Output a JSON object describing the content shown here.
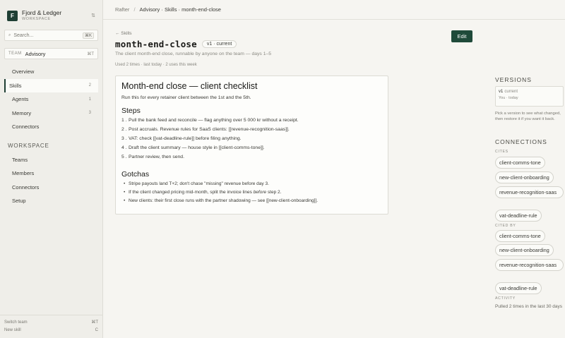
{
  "org": {
    "logo_letter": "F",
    "name": "Fjord & Ledger",
    "subtitle": "WORKSPACE",
    "chevron": "⇅"
  },
  "search": {
    "placeholder": "Search...",
    "shortcut": "⌘K"
  },
  "team": {
    "label": "TEAM",
    "value": "Advisory",
    "shortcut": "⌘T"
  },
  "nav": {
    "items": [
      {
        "label": "Overview",
        "count": ""
      },
      {
        "label": "Skills",
        "count": "2"
      },
      {
        "label": "Agents",
        "count": "1"
      },
      {
        "label": "Memory",
        "count": "3"
      },
      {
        "label": "Connectors",
        "count": ""
      }
    ],
    "workspace_heading": "WORKSPACE",
    "workspace_items": [
      {
        "label": "Teams"
      },
      {
        "label": "Members"
      },
      {
        "label": "Connectors"
      },
      {
        "label": "Setup"
      }
    ]
  },
  "footer": [
    {
      "label": "Switch team",
      "shortcut": "⌘T"
    },
    {
      "label": "New skill",
      "shortcut": "C"
    }
  ],
  "breadcrumb": {
    "root": "Rafter",
    "separator": "/",
    "path": "Advisory · Skills · month-end-close"
  },
  "page": {
    "back_link": "← Skills",
    "title": "month-end-close",
    "version_badge": "v1 · current",
    "subtitle": "The client month-end close, runnable by anyone on the team — days 1–5",
    "meta": "Used 2 times · last today · 2 uses this week",
    "edit_label": "Edit"
  },
  "doc": {
    "h1": "Month-end close — client checklist",
    "intro": "Run this for every retainer client between the 1st and the 5th.",
    "steps_heading": "Steps",
    "steps": [
      {
        "num": "1 .",
        "text": "Pull the bank feed and reconcile — flag anything over 5 000 kr without a receipt."
      },
      {
        "num": "2 .",
        "text": "Post accruals. Revenue rules for SaaS clients: [[revenue-recognition-saas]]."
      },
      {
        "num": "3 .",
        "text": "VAT: check [[vat-deadline-rule]] before filing anything."
      },
      {
        "num": "4 .",
        "text": "Draft the client summary — house style in [[client-comms-tone]]."
      },
      {
        "num": "5 .",
        "text": "Partner review, then send."
      }
    ],
    "gotchas_heading": "Gotchas",
    "gotchas": [
      {
        "text": "Stripe payouts land T+2; don't chase \"missing\" revenue before day 3."
      },
      {
        "text_before": "If the client changed pricing mid-month, split the invoice lines ",
        "emphasis": "before",
        "text_after": " step 2."
      },
      {
        "text": "New clients: their first close runs with the partner shadowing — see [[new-client-onboarding]]."
      }
    ]
  },
  "versions": {
    "heading": "VERSIONS",
    "card": {
      "version": "v1",
      "status": "current",
      "by": "You · today"
    },
    "note": "Pick a version to see what changed, then restore it if you want it back."
  },
  "connections": {
    "heading": "CONNECTIONS",
    "cites_label": "CITES",
    "cites": [
      "client-comms-tone",
      "new-client-onboarding",
      "revenue-recognition-saas",
      "vat-deadline-rule"
    ],
    "cited_by_label": "CITED BY",
    "cited_by": [
      "client-comms-tone",
      "new-client-onboarding",
      "revenue-recognition-saas",
      "vat-deadline-rule"
    ],
    "activity_label": "ACTIVITY",
    "activity_text": "Pulled 2 times in the last 30 days"
  }
}
